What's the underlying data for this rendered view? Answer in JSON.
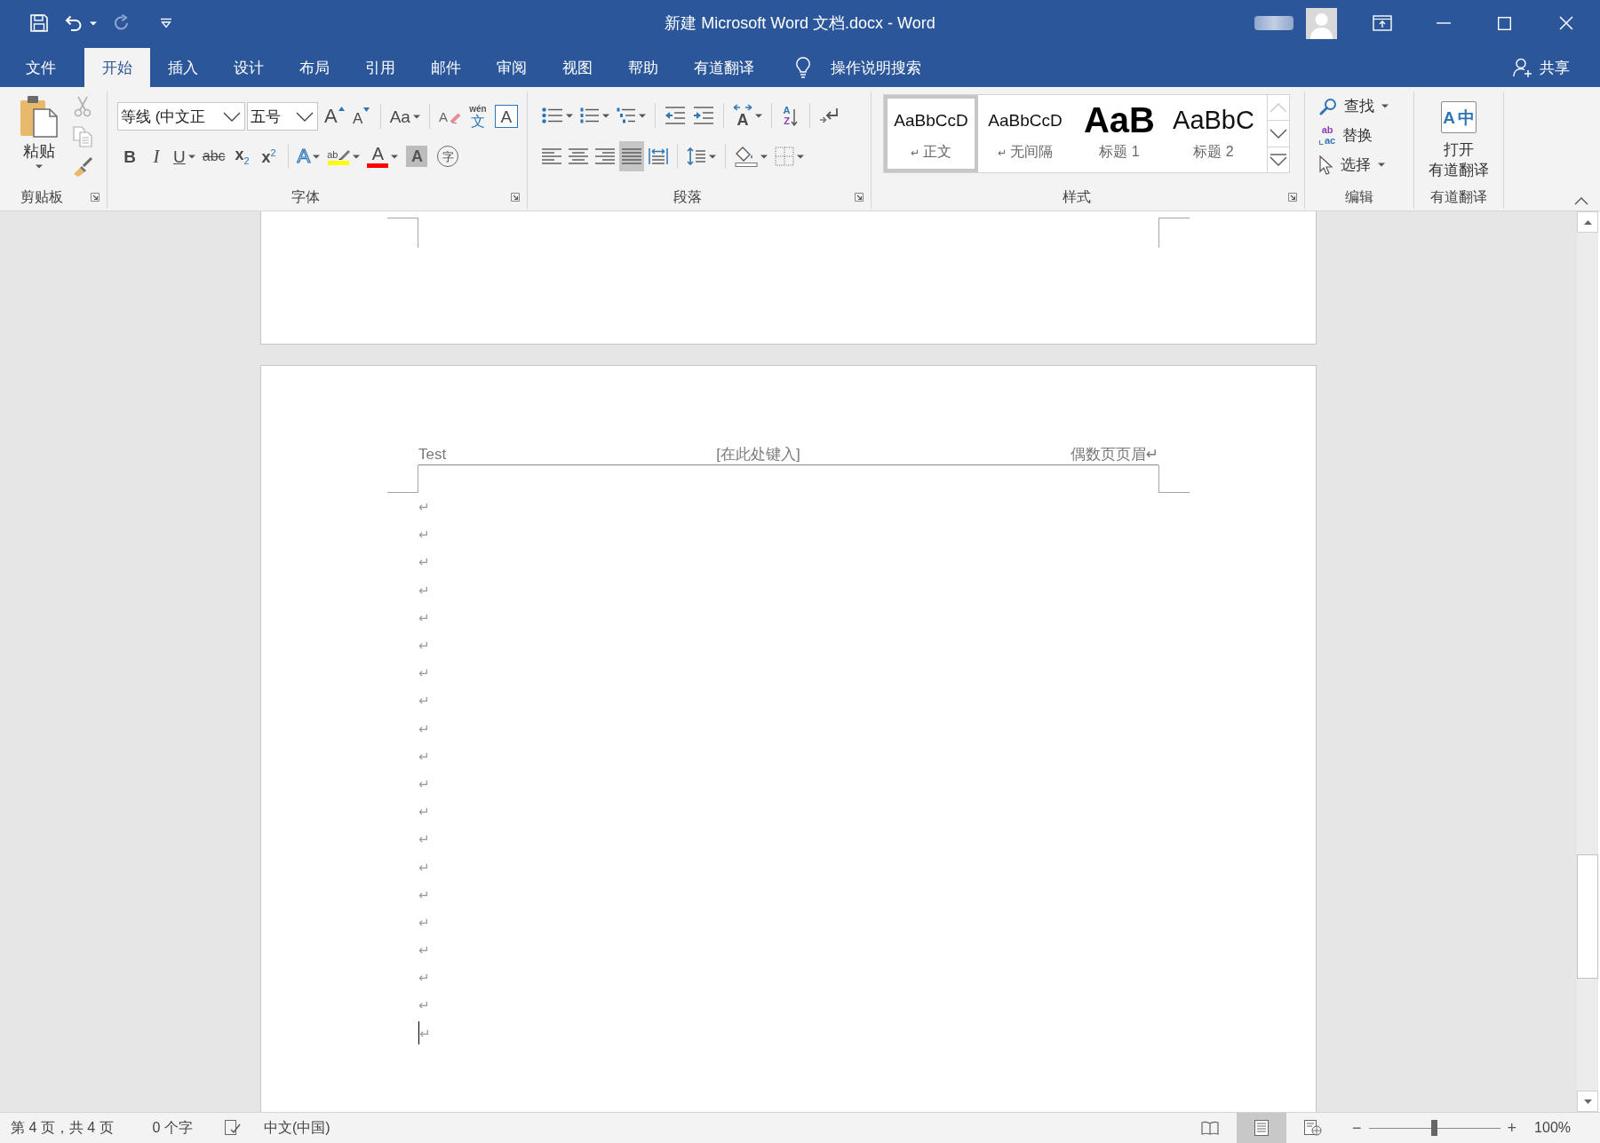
{
  "window": {
    "title": "新建 Microsoft Word 文档.docx - Word"
  },
  "quick_access": [
    {
      "kind": "save",
      "disabled": false,
      "dropdown": false
    },
    {
      "kind": "undo",
      "disabled": false,
      "dropdown": true
    },
    {
      "kind": "redo",
      "disabled": true,
      "dropdown": false
    },
    {
      "kind": "customize",
      "disabled": false,
      "dropdown": false
    }
  ],
  "tabs": [
    {
      "label": "文件",
      "selected": false
    },
    {
      "label": "开始",
      "selected": true
    },
    {
      "label": "插入",
      "selected": false
    },
    {
      "label": "设计",
      "selected": false
    },
    {
      "label": "布局",
      "selected": false
    },
    {
      "label": "引用",
      "selected": false
    },
    {
      "label": "邮件",
      "selected": false
    },
    {
      "label": "审阅",
      "selected": false
    },
    {
      "label": "视图",
      "selected": false
    },
    {
      "label": "帮助",
      "selected": false
    },
    {
      "label": "有道翻译",
      "selected": false
    }
  ],
  "tell_me": {
    "label": "操作说明搜索"
  },
  "share": {
    "label": "共享"
  },
  "ribbon": {
    "groups": [
      {
        "kind": "clipboard",
        "label": "剪贴板",
        "launcher": true,
        "paste": {
          "label": "粘贴"
        },
        "tools": [
          {
            "kind": "cut",
            "disabled": true
          },
          {
            "kind": "copy",
            "disabled": true
          },
          {
            "kind": "format_painter",
            "disabled": false
          }
        ]
      },
      {
        "kind": "font",
        "label": "字体",
        "launcher": true,
        "font_name": "等线 (中文正",
        "font_size": "五号",
        "upper_tools": [
          {
            "kind": "grow",
            "glyph": "A",
            "dropdown": false
          },
          {
            "kind": "shrink",
            "glyph": "A",
            "dropdown": false
          },
          {
            "kind": "separator"
          },
          {
            "kind": "case",
            "glyph": "Aa",
            "dropdown": true
          },
          {
            "kind": "separator"
          },
          {
            "kind": "clear",
            "glyph": "A",
            "dropdown": false
          },
          {
            "kind": "phonetic",
            "glyph": "文",
            "sub_glyph": "wén",
            "dropdown": false
          },
          {
            "kind": "char_border",
            "glyph": "A",
            "dropdown": false
          }
        ],
        "lower_tools": [
          {
            "kind": "bold",
            "glyph": "B",
            "dropdown": false
          },
          {
            "kind": "italic",
            "glyph": "I",
            "dropdown": false
          },
          {
            "kind": "underline",
            "glyph": "U",
            "dropdown": true
          },
          {
            "kind": "strike",
            "glyph": "abc",
            "dropdown": false
          },
          {
            "kind": "subscript",
            "glyph": "x$_{2}$",
            "dropdown": false
          },
          {
            "kind": "superscript",
            "glyph": "x$^{2}$",
            "dropdown": false
          },
          {
            "kind": "separator"
          },
          {
            "kind": "effects",
            "glyph": "A",
            "dropdown": true
          },
          {
            "kind": "highlight",
            "glyph": "ab",
            "color": "#ffff00",
            "dropdown": true
          },
          {
            "kind": "font_color",
            "glyph": "A",
            "color": "#ff0000",
            "dropdown": true
          },
          {
            "kind": "char_shading",
            "glyph": "A",
            "dropdown": false
          },
          {
            "kind": "enclose",
            "glyph": "字",
            "dropdown": false
          }
        ]
      },
      {
        "kind": "paragraph",
        "label": "段落",
        "launcher": true,
        "upper_tools": [
          {
            "kind": "bullets",
            "dropdown": true
          },
          {
            "kind": "numbering",
            "dropdown": true
          },
          {
            "kind": "multilevel",
            "dropdown": true
          },
          {
            "kind": "separator"
          },
          {
            "kind": "outdent",
            "dropdown": false
          },
          {
            "kind": "indent",
            "dropdown": false
          },
          {
            "kind": "separator"
          },
          {
            "kind": "asian_layout",
            "glyph": "A",
            "dropdown": true
          },
          {
            "kind": "separator"
          },
          {
            "kind": "sort",
            "glyph": "A",
            "sub_glyph": "Z",
            "dropdown": false
          },
          {
            "kind": "separator"
          },
          {
            "kind": "show_marks",
            "dropdown": false
          }
        ],
        "lower_tools": [
          {
            "kind": "align_left",
            "selected": false,
            "dropdown": false
          },
          {
            "kind": "align_center",
            "selected": false,
            "dropdown": false
          },
          {
            "kind": "align_right",
            "selected": false,
            "dropdown": false
          },
          {
            "kind": "justify",
            "selected": true,
            "dropdown": false
          },
          {
            "kind": "distribute",
            "selected": false,
            "dropdown": false
          },
          {
            "kind": "separator"
          },
          {
            "kind": "line_spacing",
            "dropdown": true
          },
          {
            "kind": "separator"
          },
          {
            "kind": "shading",
            "dropdown": true
          },
          {
            "kind": "borders",
            "dropdown": true
          }
        ]
      },
      {
        "kind": "styles",
        "label": "样式",
        "launcher": true,
        "styles": [
          {
            "kind": "normal",
            "preview": "AaBbCcD",
            "mark": "↵",
            "name": "正文",
            "selected": true
          },
          {
            "kind": "normal",
            "preview": "AaBbCcD",
            "mark": "↵",
            "name": "无间隔",
            "selected": false
          },
          {
            "kind": "heading1",
            "preview": "AaB",
            "name": "标题 1",
            "selected": false
          },
          {
            "kind": "heading2",
            "preview": "AaBbC",
            "name": "标题 2",
            "selected": false
          }
        ],
        "scroll": [
          {
            "kind": "up",
            "disabled": true
          },
          {
            "kind": "down",
            "disabled": false
          },
          {
            "kind": "more",
            "disabled": false
          }
        ]
      },
      {
        "kind": "editing",
        "label": "编辑",
        "launcher": false,
        "items": [
          {
            "kind": "find",
            "label": "查找",
            "dropdown": true
          },
          {
            "kind": "replace",
            "label": "替换",
            "glyph": "ab",
            "sub_glyph": "ac",
            "dropdown": false
          },
          {
            "kind": "select",
            "label": "选择",
            "dropdown": true
          }
        ]
      },
      {
        "kind": "youdao",
        "label": "有道翻译",
        "launcher": false,
        "button": {
          "label_lines": [
            "打开",
            "有道翻译"
          ],
          "glyph": "A",
          "sub_glyph": "中"
        }
      }
    ]
  },
  "document": {
    "header": {
      "left": "Test",
      "center": "[在此处键入]",
      "right": "偶数页页眉↵"
    },
    "paragraphs": [
      {
        "mark": "↵",
        "cursor": false
      },
      {
        "mark": "↵",
        "cursor": false
      },
      {
        "mark": "↵",
        "cursor": false
      },
      {
        "mark": "↵",
        "cursor": false
      },
      {
        "mark": "↵",
        "cursor": false
      },
      {
        "mark": "↵",
        "cursor": false
      },
      {
        "mark": "↵",
        "cursor": false
      },
      {
        "mark": "↵",
        "cursor": false
      },
      {
        "mark": "↵",
        "cursor": false
      },
      {
        "mark": "↵",
        "cursor": false
      },
      {
        "mark": "↵",
        "cursor": false
      },
      {
        "mark": "↵",
        "cursor": false
      },
      {
        "mark": "↵",
        "cursor": false
      },
      {
        "mark": "↵",
        "cursor": false
      },
      {
        "mark": "↵",
        "cursor": false
      },
      {
        "mark": "↵",
        "cursor": false
      },
      {
        "mark": "↵",
        "cursor": false
      },
      {
        "mark": "↵",
        "cursor": false
      },
      {
        "mark": "↵",
        "cursor": false
      },
      {
        "mark": "↵",
        "cursor": true
      }
    ]
  },
  "status_bar": {
    "page": "第 4 页，共 4 页",
    "words": "0 个字",
    "language": "中文(中国)",
    "views": [
      {
        "kind": "read",
        "selected": false
      },
      {
        "kind": "print",
        "selected": true
      },
      {
        "kind": "web",
        "selected": false
      }
    ],
    "zoom": {
      "minus": "−",
      "plus": "+",
      "level": 0.5,
      "reading": "100%"
    }
  }
}
